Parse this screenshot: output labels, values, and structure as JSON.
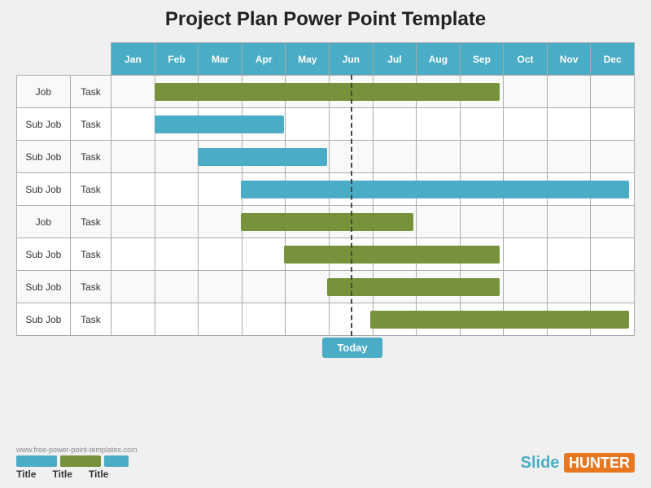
{
  "title": "Project Plan Power Point Template",
  "months": [
    "Jan",
    "Feb",
    "Mar",
    "Apr",
    "May",
    "Jun",
    "Jul",
    "Aug",
    "Sep",
    "Oct",
    "Nov",
    "Dec"
  ],
  "rows": [
    {
      "job": "Job",
      "task": "Task",
      "bar": {
        "color": "green",
        "start": 1,
        "span": 8
      }
    },
    {
      "job": "Sub Job",
      "task": "Task",
      "bar": {
        "color": "blue",
        "start": 1,
        "span": 3
      }
    },
    {
      "job": "Sub Job",
      "task": "Task",
      "bar": {
        "color": "blue",
        "start": 2,
        "span": 3
      }
    },
    {
      "job": "Sub Job",
      "task": "Task",
      "bar": {
        "color": "blue",
        "start": 3,
        "span": 9
      }
    },
    {
      "job": "Job",
      "task": "Task",
      "bar": {
        "color": "green",
        "start": 3,
        "span": 4
      }
    },
    {
      "job": "Sub Job",
      "task": "Task",
      "bar": {
        "color": "green",
        "start": 4,
        "span": 5
      }
    },
    {
      "job": "Sub Job",
      "task": "Task",
      "bar": {
        "color": "green",
        "start": 5,
        "span": 4
      }
    },
    {
      "job": "Sub Job",
      "task": "Task",
      "bar": {
        "color": "green",
        "start": 6,
        "span": 6
      }
    }
  ],
  "today": {
    "label": "Today",
    "month_index": 5
  },
  "footer": {
    "watermark": "www.free-power-point-templates.com",
    "legend_items": [
      "Title",
      "Title",
      "Title"
    ],
    "brand": "Slide HUNTER"
  }
}
